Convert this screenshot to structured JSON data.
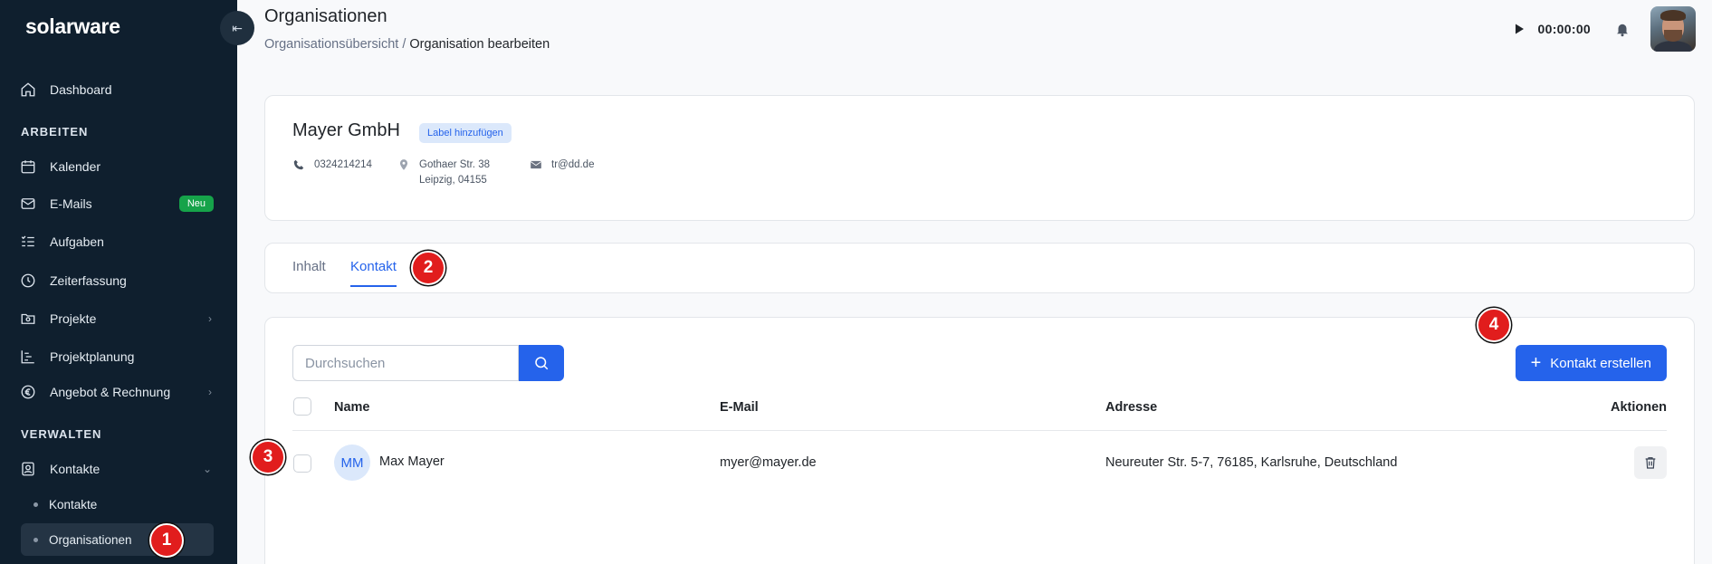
{
  "app": {
    "logo": "solarware"
  },
  "sidebar": {
    "collapse_icon": "collapse-left-icon",
    "items": [
      {
        "label": "Dashboard",
        "icon": "home-icon"
      },
      {
        "label": "Kalender",
        "icon": "calendar-icon"
      },
      {
        "label": "E-Mails",
        "icon": "mail-icon",
        "badge": "Neu"
      },
      {
        "label": "Aufgaben",
        "icon": "tasks-icon"
      },
      {
        "label": "Zeiterfassung",
        "icon": "clock-icon"
      },
      {
        "label": "Projekte",
        "icon": "folder-icon"
      },
      {
        "label": "Projektplanung",
        "icon": "gantt-icon"
      },
      {
        "label": "Angebot & Rechnung",
        "icon": "euro-icon"
      },
      {
        "label": "Kontakte",
        "icon": "contact-icon"
      }
    ],
    "sections": {
      "work": "ARBEITEN",
      "manage": "VERWALTEN"
    },
    "sub_items": [
      {
        "label": "Kontakte"
      },
      {
        "label": "Organisationen",
        "active": true
      }
    ]
  },
  "header": {
    "title": "Organisationen",
    "breadcrumb_parent": "Organisationsübersicht",
    "breadcrumb_sep": " / ",
    "breadcrumb_current": "Organisation bearbeiten",
    "timer": "00:00:00"
  },
  "organization": {
    "name": "Mayer GmbH",
    "label_button": "Label hinzufügen",
    "phone": "0324214214",
    "address_line1": "Gothaer Str. 38",
    "address_line2": "Leipzig, 04155",
    "email": "tr@dd.de"
  },
  "tabs": [
    {
      "label": "Inhalt"
    },
    {
      "label": "Kontakt",
      "active": true
    }
  ],
  "contacts": {
    "search_placeholder": "Durchsuchen",
    "create_button": "Kontakt erstellen",
    "columns": [
      "Name",
      "E-Mail",
      "Adresse",
      "Aktionen"
    ],
    "rows": [
      {
        "initials": "MM",
        "name": "Max Mayer",
        "email": "myer@mayer.de",
        "address": "Neureuter Str. 5-7, 76185, Karlsruhe, Deutschland"
      }
    ]
  },
  "markers": [
    "1",
    "2",
    "3",
    "4"
  ],
  "colors": {
    "sidebar": "#0f1f2e",
    "accent": "#2563eb",
    "badge_green": "#16a34a",
    "marker_red": "#e11d1d"
  }
}
